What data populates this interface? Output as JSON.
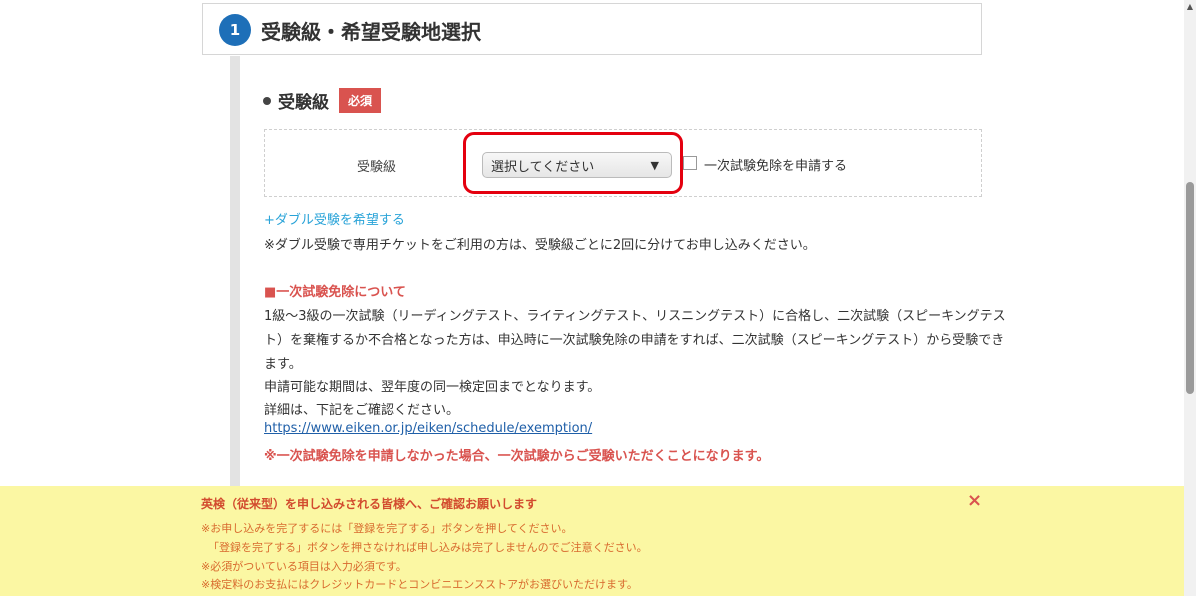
{
  "section": {
    "step_number": "1",
    "title": "受験級・希望受験地選択"
  },
  "field": {
    "heading": "受験級",
    "required_badge": "必須",
    "label": "受験級",
    "select_value": "選択してください",
    "exempt_checkbox_label": "一次試験免除を申請する"
  },
  "double_exam": {
    "link": "+ダブル受験を希望する",
    "note": "※ダブル受験で専用チケットをご利用の方は、受験級ごとに2回に分けてお申し込みください。"
  },
  "exemption": {
    "heading": "■一次試験免除について",
    "lines": [
      "1級〜3級の一次試験（リーディングテスト、ライティングテスト、リスニングテスト）に合格し、二次試験（スピーキングテス",
      "ト）を棄権するか不合格となった方は、申込時に一次試験免除の申請をすれば、二次試験（スピーキングテスト）から受験でき",
      "ます。",
      "申請可能な期間は、翌年度の同一検定回までとなります。",
      "詳細は、下記をご確認ください。"
    ],
    "url": "https://www.eiken.or.jp/eiken/schedule/exemption/",
    "warning": "※一次試験免除を申請しなかった場合、一次試験からご受験いただくことになります。"
  },
  "notice": {
    "title": "英検（従来型）を申し込みされる皆様へ、ご確認お願いします",
    "close_icon": "×",
    "lines": [
      "※お申し込みを完了するには「登録を完了する」ボタンを押してください。",
      "「登録を完了する」ボタンを押さなければ申し込みは完了しませんのでご注意ください。",
      "※必須がついている項目は入力必須です。",
      "※検定料のお支払にはクレジットカードとコンビニエンスストアがお選びいただけます。"
    ]
  },
  "colors": {
    "accent": "#1e6fb8",
    "required": "#d9534f",
    "highlight": "#e4000f",
    "notice_bg": "#fbf7a3",
    "link": "#29a3d8"
  }
}
